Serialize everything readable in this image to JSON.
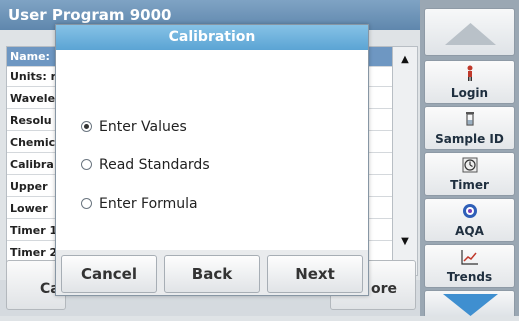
{
  "background": {
    "header_title": "User Program   9000",
    "list_rows": [
      "Name:",
      "Units: r",
      "Wavele",
      "Resolu",
      "Chemic",
      "Calibra",
      "Upper",
      "Lower",
      "Timer 1",
      "Timer 2"
    ],
    "footer_left_label": "Ca",
    "footer_right_label": "ore"
  },
  "sidebar": {
    "items": [
      {
        "label": "Login",
        "icon": "person-icon"
      },
      {
        "label": "Sample ID",
        "icon": "vial-icon"
      },
      {
        "label": "Timer",
        "icon": "timer-icon"
      },
      {
        "label": "AQA",
        "icon": "aqa-icon"
      },
      {
        "label": "Trends",
        "icon": "trends-icon"
      }
    ]
  },
  "dialog": {
    "title": "Calibration",
    "options": [
      {
        "label": "Enter Values",
        "selected": true
      },
      {
        "label": "Read Standards",
        "selected": false
      },
      {
        "label": "Enter Formula",
        "selected": false
      }
    ],
    "buttons": {
      "cancel": "Cancel",
      "back": "Back",
      "next": "Next"
    }
  },
  "colors": {
    "title_bar": "#5ba4d4",
    "selection": "#6e97c2",
    "side_panel": "#9aa7b3",
    "arrow_blue": "#3f8fd0"
  }
}
